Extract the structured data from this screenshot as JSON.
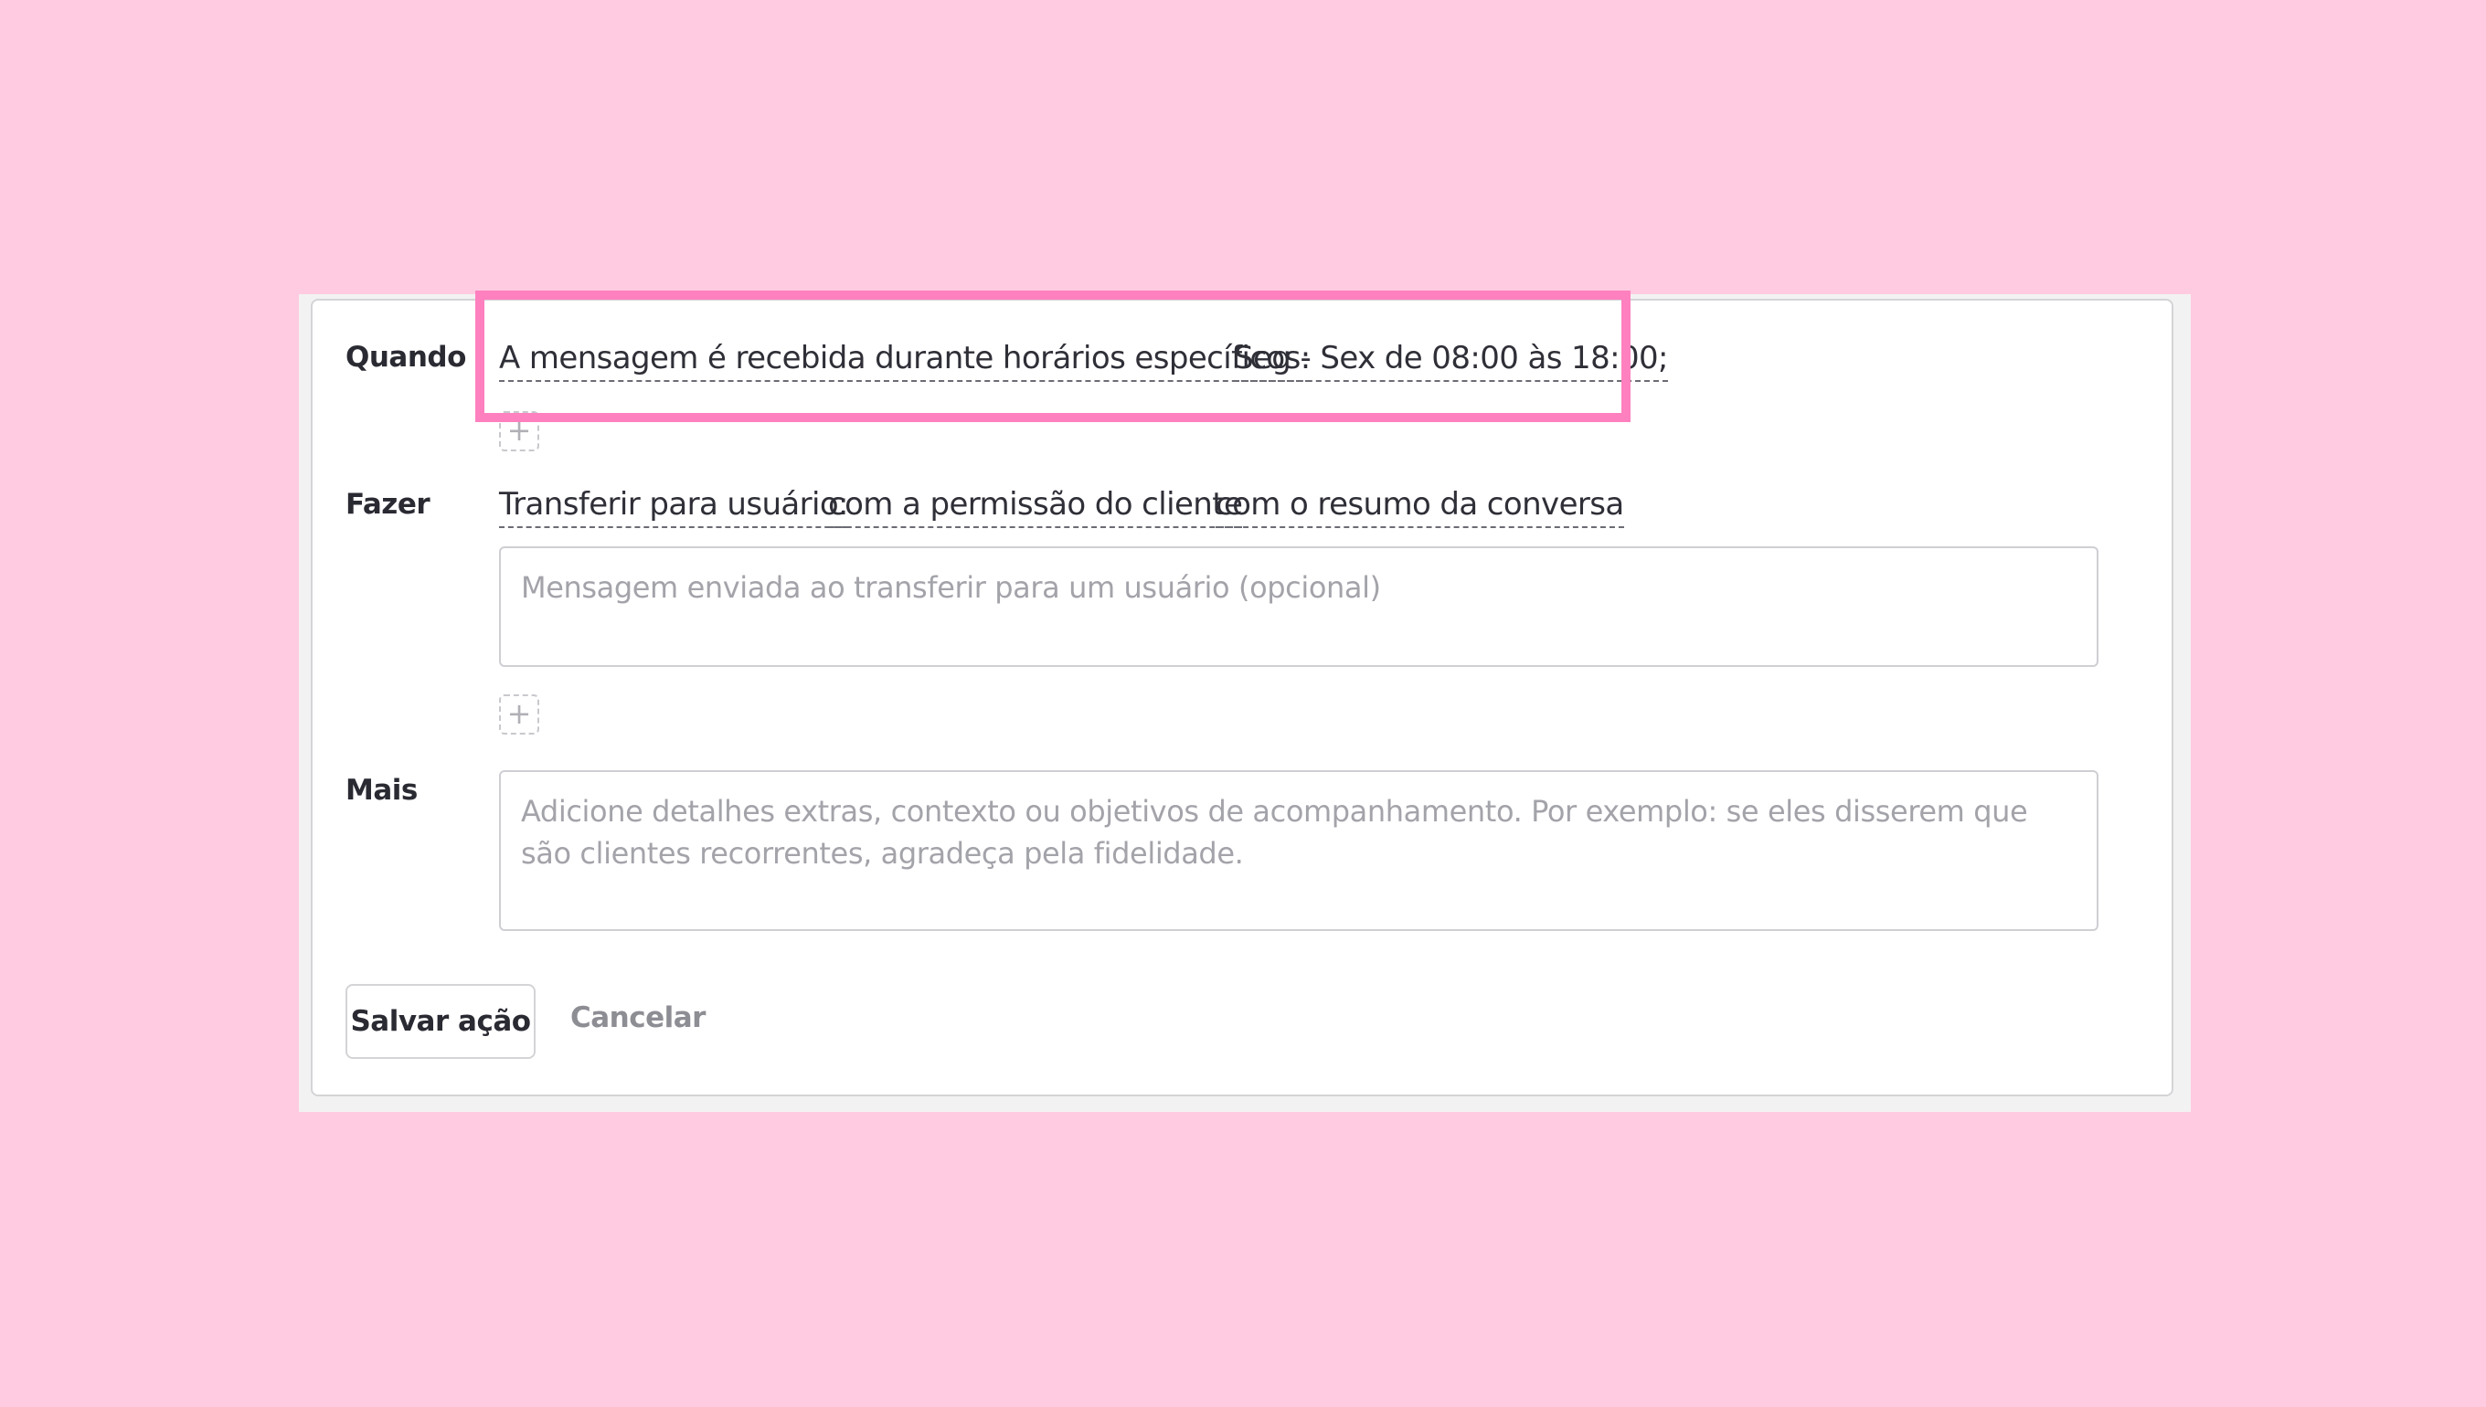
{
  "form": {
    "when": {
      "label": "Quando",
      "condition": "A mensagem é recebida durante horários específicos:",
      "schedule": "Seg - Sex de 08:00 às 18:00;"
    },
    "do": {
      "label": "Fazer",
      "action": "Transferir para usuário:",
      "option_permission": "com a permissão do cliente",
      "option_summary": "com o resumo da conversa",
      "message_placeholder": "Mensagem enviada ao transferir para um usuário (opcional)"
    },
    "more": {
      "label": "Mais",
      "placeholder": "Adicione detalhes extras, contexto ou objetivos de acompanhamento. Por exemplo: se eles disserem que são clientes recorrentes, agradeça pela fidelidade."
    },
    "add_symbol": "+",
    "save_label": "Salvar ação",
    "cancel_label": "Cancelar"
  },
  "colors": {
    "background": "#ffcbe1",
    "highlight": "#ff80bf",
    "card_border": "#d4d3d6"
  }
}
